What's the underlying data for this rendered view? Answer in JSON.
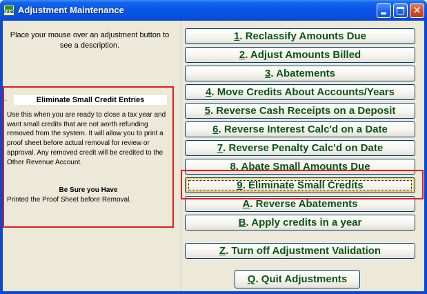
{
  "window": {
    "title": "Adjustment Maintenance",
    "app_icon_text": "FUND",
    "close_glyph": "✕"
  },
  "left": {
    "hint": "Place your mouse over an adjustment button to see a description.",
    "desc_title": "Eliminate Small Credit Entries",
    "desc_body": "Use this when you are ready to close a tax year and want small credits that are not worth refunding removed from the system.  It will allow you to print a proof sheet before actual removal for review or approval. Any removed credit will be credited to the Other Revenue Account.",
    "desc_subheading": "Be Sure you Have",
    "desc_footer": "Printed the Proof Sheet before Removal."
  },
  "buttons": [
    {
      "key": "1",
      "rest": ".  Reclassify Amounts Due"
    },
    {
      "key": "2",
      "rest": ". Adjust Amounts Billed"
    },
    {
      "key": "3",
      "rest": ". Abatements"
    },
    {
      "key": "4",
      "rest": ". Move Credits About Accounts/Years"
    },
    {
      "key": "5",
      "rest": ". Reverse Cash Receipts on a Deposit"
    },
    {
      "key": "6",
      "rest": ". Reverse Interest Calc'd on a Date"
    },
    {
      "key": "7",
      "rest": ". Reverse Penalty Calc'd on Date"
    },
    {
      "key": "8",
      "rest": ". Abate Small Amounts Due"
    },
    {
      "key": "9",
      "rest": ". Eliminate Small Credits"
    },
    {
      "key": "A",
      "rest": ". Reverse Abatements"
    },
    {
      "key": "B",
      "rest": ". Apply credits in a year"
    },
    {
      "key": "Z",
      "rest": ". Turn off Adjustment Validation"
    }
  ],
  "quit": {
    "key": "Q",
    "rest": ".  Quit Adjustments"
  },
  "colors": {
    "button_text": "#0b5516",
    "highlight": "#e31b1b",
    "titlebar": "#0a55e6"
  }
}
